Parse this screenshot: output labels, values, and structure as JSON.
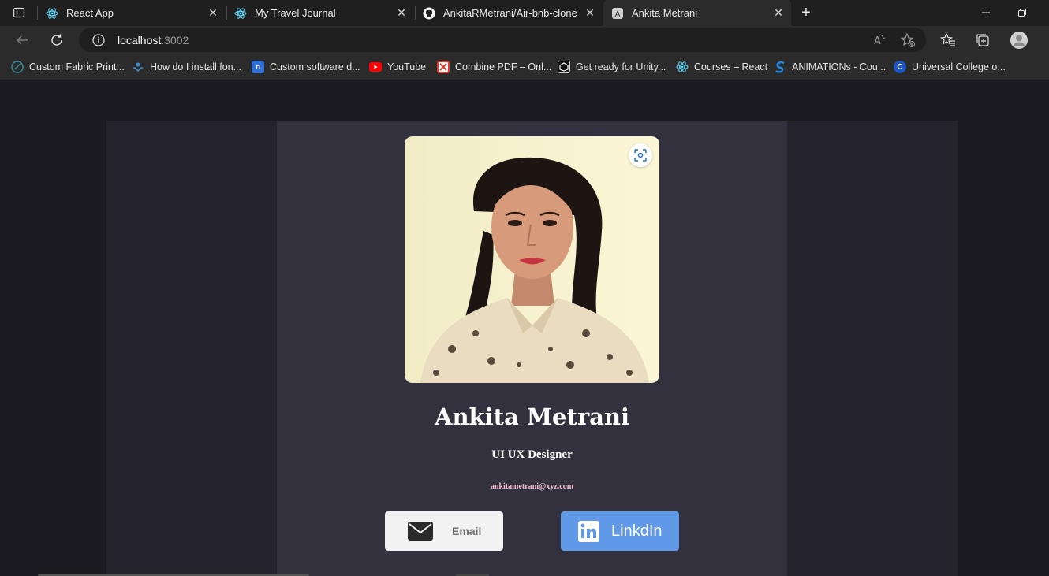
{
  "tabs": [
    {
      "title": "React App",
      "icon": "react-icon"
    },
    {
      "title": "My Travel Journal",
      "icon": "react-icon"
    },
    {
      "title": "AnkitaRMetrani/Air-bnb-clone",
      "icon": "github-icon"
    },
    {
      "title": "Ankita Metrani",
      "icon": "app-icon",
      "active": true
    }
  ],
  "address_bar": {
    "host": "localhost",
    "port": ":3002"
  },
  "bookmarks": [
    {
      "label": "Custom Fabric Print...",
      "icon": "globe-icon",
      "color": "#3a8fa0"
    },
    {
      "label": "How do I install fon...",
      "icon": "bird-icon",
      "color": "#3f8fd0"
    },
    {
      "label": "Custom software d...",
      "icon": "n-logo-icon",
      "color": "#2e6fd8"
    },
    {
      "label": "YouTube",
      "icon": "youtube-icon",
      "color": "#ff0000"
    },
    {
      "label": "Combine PDF – Onl...",
      "icon": "pdf-icon",
      "color": "#e2382d"
    },
    {
      "label": "Get ready for Unity...",
      "icon": "unity-icon",
      "color": "#111111"
    },
    {
      "label": "Courses – React",
      "icon": "react-icon",
      "color": "#61dafb"
    },
    {
      "label": "ANIMATIONs - Cou...",
      "icon": "s-logo-icon",
      "color": "#1e88e5"
    },
    {
      "label": "Universal College o...",
      "icon": "c-logo-icon",
      "color": "#1a56c4"
    }
  ],
  "profile": {
    "name": "Ankita Metrani",
    "role": "UI UX Designer",
    "email": "ankitametrani@xyz.com"
  },
  "buttons": {
    "email_label": "Email",
    "linkedin_label": "LinkdIn"
  },
  "colors": {
    "page_bg": "#1c1b22",
    "card_bg": "#33313e",
    "linkedin_blue": "#5f99e8",
    "email_pink": "#f3bfd3"
  }
}
